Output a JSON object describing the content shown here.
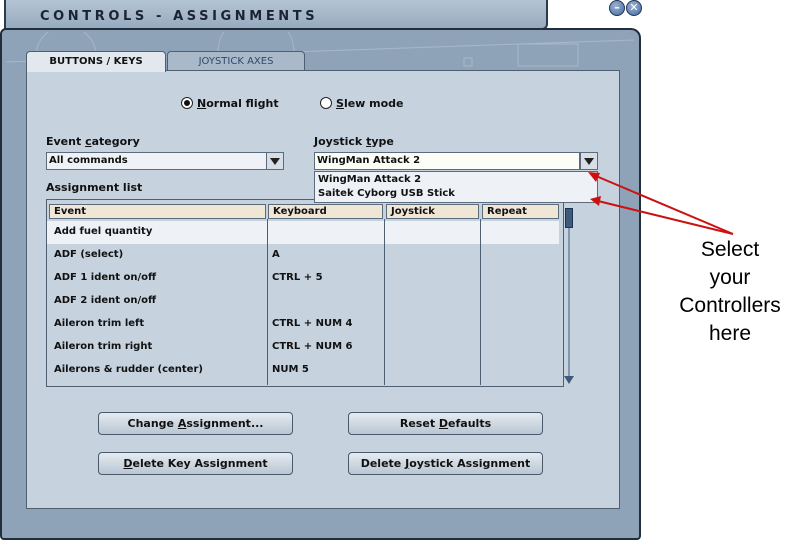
{
  "window": {
    "title": "CONTROLS - ASSIGNMENTS"
  },
  "window_controls": {
    "minimize_glyph": "–",
    "close_glyph": "✕"
  },
  "tabs": [
    {
      "label": "BUTTONS / KEYS",
      "active": true
    },
    {
      "label": "JOYSTICK AXES",
      "active": false
    }
  ],
  "mode": {
    "normal_flight": {
      "first": "N",
      "rest": "ormal flight",
      "selected": true
    },
    "slew_mode": {
      "first": "S",
      "rest": "lew mode",
      "selected": false
    }
  },
  "event_category": {
    "label_pre": "Event ",
    "label_ul": "c",
    "label_post": "ategory",
    "value": "All commands"
  },
  "joystick_type": {
    "label_pre": "Joystick ",
    "label_ul": "t",
    "label_post": "ype",
    "value": "WingMan Attack 2",
    "options": [
      "WingMan Attack 2",
      "Saitek Cyborg USB Stick"
    ]
  },
  "assignment_list": {
    "label": "Assignment list",
    "columns": [
      "Event",
      "Keyboard",
      "Joystick",
      "Repeat"
    ],
    "rows": [
      {
        "event": "Add fuel quantity",
        "keyboard": "",
        "joystick": "",
        "repeat": ""
      },
      {
        "event": "ADF (select)",
        "keyboard": "A",
        "joystick": "",
        "repeat": ""
      },
      {
        "event": "ADF 1 ident on/off",
        "keyboard": "CTRL + 5",
        "joystick": "",
        "repeat": ""
      },
      {
        "event": "ADF 2 ident on/off",
        "keyboard": "",
        "joystick": "",
        "repeat": ""
      },
      {
        "event": "Aileron trim left",
        "keyboard": "CTRL + NUM 4",
        "joystick": "",
        "repeat": ""
      },
      {
        "event": "Aileron trim right",
        "keyboard": "CTRL + NUM 6",
        "joystick": "",
        "repeat": ""
      },
      {
        "event": "Ailerons & rudder (center)",
        "keyboard": "NUM 5",
        "joystick": "",
        "repeat": ""
      }
    ],
    "selected_row": 0
  },
  "buttons": {
    "change_assignment": {
      "pre": "Change ",
      "ul": "A",
      "post": "ssignment..."
    },
    "reset_defaults": {
      "pre": "Reset ",
      "ul": "D",
      "post": "efaults"
    },
    "delete_key_assignment": {
      "pre": "",
      "ul": "D",
      "post": "elete Key Assignment"
    },
    "delete_joystick_assignment": {
      "pre": "Delete ",
      "ul": "J",
      "post": "oystick Assignment"
    }
  },
  "annotation": {
    "lines": [
      "Select",
      "your",
      "Controllers",
      "here"
    ],
    "arrow_color": "#cc1111"
  },
  "colors": {
    "panel": "#c6d2de",
    "frame": "#8ea2b8",
    "header_cell": "#f0e6d6",
    "arrow": "#cc1111"
  }
}
